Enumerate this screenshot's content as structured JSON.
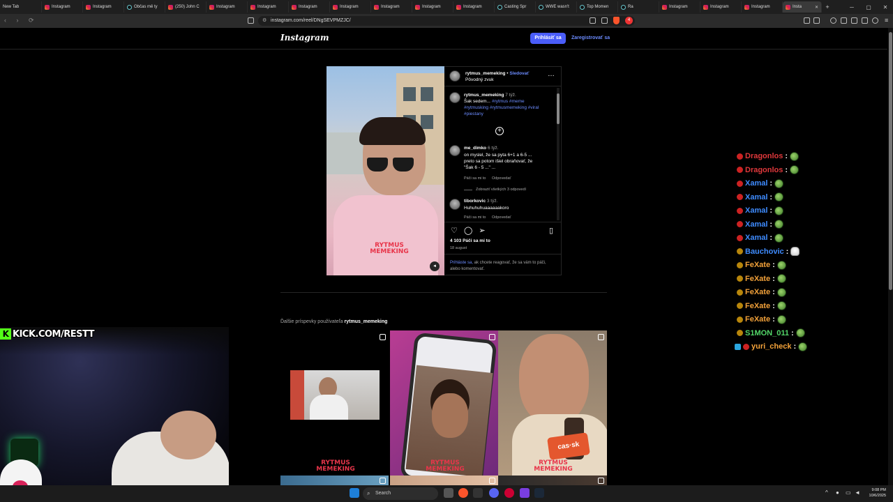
{
  "browser": {
    "tabs": [
      {
        "label": "New Tab",
        "icon": "blank"
      },
      {
        "label": "Instagram",
        "icon": "instagram"
      },
      {
        "label": "Instagram",
        "icon": "instagram"
      },
      {
        "label": "Občas mě ty",
        "icon": "tiktok"
      },
      {
        "label": "(250) John C",
        "icon": "instagram"
      },
      {
        "label": "Instagram",
        "icon": "instagram"
      },
      {
        "label": "Instagram",
        "icon": "instagram"
      },
      {
        "label": "Instagram",
        "icon": "instagram"
      },
      {
        "label": "Instagram",
        "icon": "instagram"
      },
      {
        "label": "Instagram",
        "icon": "instagram"
      },
      {
        "label": "Instagram",
        "icon": "instagram"
      },
      {
        "label": "Instagram",
        "icon": "instagram"
      },
      {
        "label": "Casting Spr",
        "icon": "tiktok"
      },
      {
        "label": "WWE wasn't",
        "icon": "tiktok"
      },
      {
        "label": "Top Momen",
        "icon": "tiktok"
      },
      {
        "label": "Ra",
        "icon": "tiktok"
      },
      {
        "label": "Instagram",
        "icon": "instagram"
      },
      {
        "label": "Instagram",
        "icon": "instagram"
      },
      {
        "label": "Instagram",
        "icon": "instagram"
      },
      {
        "label": "Insta",
        "icon": "instagram"
      }
    ],
    "url": "instagram.com/reel/DNgSEVPMZJC/",
    "shields_count": "4"
  },
  "ig": {
    "logo": "Instagram",
    "login": "Prihlásiť sa",
    "signup": "Zaregistrovať sa"
  },
  "post": {
    "author": "rytmus_memeking",
    "follow": "Sledovať",
    "audio": "Pôvodný zvuk",
    "more": "…",
    "video_watermark_1": "RYTMUS",
    "video_watermark_2": "MEMEKING",
    "caption": {
      "user": "rytmus_memeking",
      "age": "7 týž.",
      "text": "Šak sedem...",
      "tags_1": "#rytmus #meme",
      "tags_2": "#rytmusking #rytmusmemeking #viral",
      "tags_3": "#piestany"
    },
    "comments": [
      {
        "user": "me_dimko",
        "age": "6 týž.",
        "lines": [
          "on myslel, že sa pyta 6+1 a 6-5 ...",
          "preto sa potom išiel obraňovať, že",
          "\"Šak 6 - 5 ...\" ..."
        ],
        "like": "Páči sa mi to",
        "reply": "Odpovedať",
        "view_replies": "Zobraziť všetkých 3 odpovedí"
      },
      {
        "user": "tiborkovic",
        "age": "3 týž.",
        "lines": [
          "Huhuhuhuaaaaaakoro"
        ],
        "like": "Páči sa mi to",
        "reply": "Odpovedať"
      }
    ],
    "likes": "4 103 Páči sa mi to",
    "date": "18 august",
    "login_prompt_link": "Prihláste sa,",
    "login_prompt_rest": " ak chcete reagovať, že sa vám to páči, alebo komentovať."
  },
  "more_posts": {
    "prefix": "Ďalšie príspevky používateľa ",
    "user": "rytmus_memeking",
    "thumb_watermark_1": "RYTMUS",
    "thumb_watermark_2": "MEMEKING",
    "mic_label": "cas·sk"
  },
  "chat": [
    {
      "user": "Dragonlos",
      "color": "#e0383b",
      "badge": "#c22"
    },
    {
      "user": "Dragonlos",
      "color": "#e0383b",
      "badge": "#c22"
    },
    {
      "user": "Xamal",
      "color": "#3f8cff",
      "badge": "#c22"
    },
    {
      "user": "Xamal",
      "color": "#3f8cff",
      "badge": "#c22"
    },
    {
      "user": "Xamal",
      "color": "#3f8cff",
      "badge": "#c22"
    },
    {
      "user": "Xamal",
      "color": "#3f8cff",
      "badge": "#c22"
    },
    {
      "user": "Xamal",
      "color": "#3f8cff",
      "badge": "#c22"
    },
    {
      "user": "Bauchovic",
      "color": "#3f8cff",
      "badge": "#b8860b",
      "ghost": true
    },
    {
      "user": "FeXate",
      "color": "#f3a23a",
      "badge": "#b8860b"
    },
    {
      "user": "FeXate",
      "color": "#f3a23a",
      "badge": "#b8860b"
    },
    {
      "user": "FeXate",
      "color": "#f3a23a",
      "badge": "#b8860b"
    },
    {
      "user": "FeXate",
      "color": "#f3a23a",
      "badge": "#b8860b"
    },
    {
      "user": "FeXate",
      "color": "#f3a23a",
      "badge": "#b8860b"
    },
    {
      "user": "S1MON_011",
      "color": "#53d769",
      "badge": "#b8860b"
    },
    {
      "user": "yuri_check",
      "color": "#f3a23a",
      "badge": "#c22",
      "badge2": "#2aa6e0"
    }
  ],
  "chat_separator": ":",
  "stream": {
    "kick_label": "KICK.COM/RESTT",
    "kick_k": "K"
  },
  "taskbar": {
    "search": "Search",
    "time": "9:08 PM",
    "date": "10/6/2025"
  }
}
